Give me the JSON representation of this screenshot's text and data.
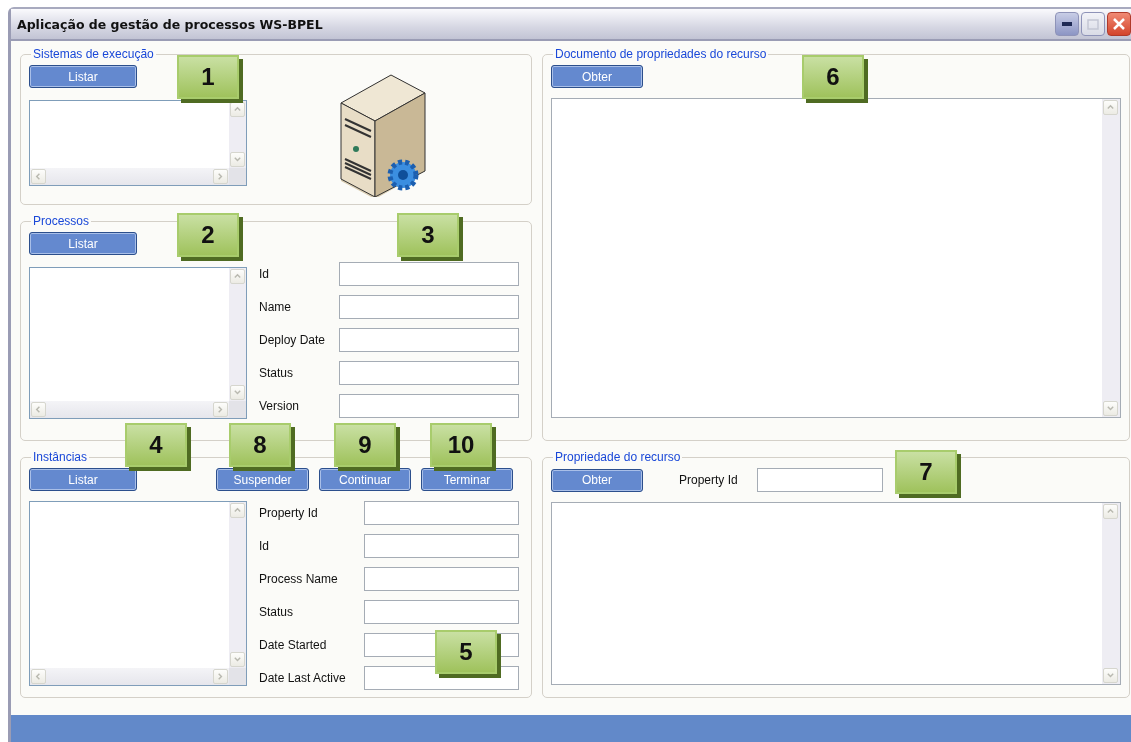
{
  "window": {
    "title": "Aplicação de gestão de processos WS-BPEL"
  },
  "execution_systems": {
    "title": "Sistemas de execução",
    "button": "Listar"
  },
  "processes": {
    "title": "Processos",
    "button": "Listar",
    "fields": [
      {
        "label": "Id"
      },
      {
        "label": "Name"
      },
      {
        "label": "Deploy Date"
      },
      {
        "label": "Status"
      },
      {
        "label": "Version"
      }
    ]
  },
  "instances": {
    "title": "Instâncias",
    "buttons": [
      "Listar",
      "Suspender",
      "Continuar",
      "Terminar"
    ],
    "fields": [
      {
        "label": "Property Id"
      },
      {
        "label": "Id"
      },
      {
        "label": "Process Name"
      },
      {
        "label": "Status"
      },
      {
        "label": "Date Started"
      },
      {
        "label": "Date Last Active"
      }
    ]
  },
  "resource_document": {
    "title": "Documento de propriedades do recurso",
    "button": "Obter"
  },
  "resource_property": {
    "title": "Propriedade do recurso",
    "button": "Obter",
    "field_label": "Property Id"
  },
  "callouts": [
    "1",
    "2",
    "3",
    "4",
    "8",
    "9",
    "10",
    "5",
    "6",
    "7"
  ]
}
